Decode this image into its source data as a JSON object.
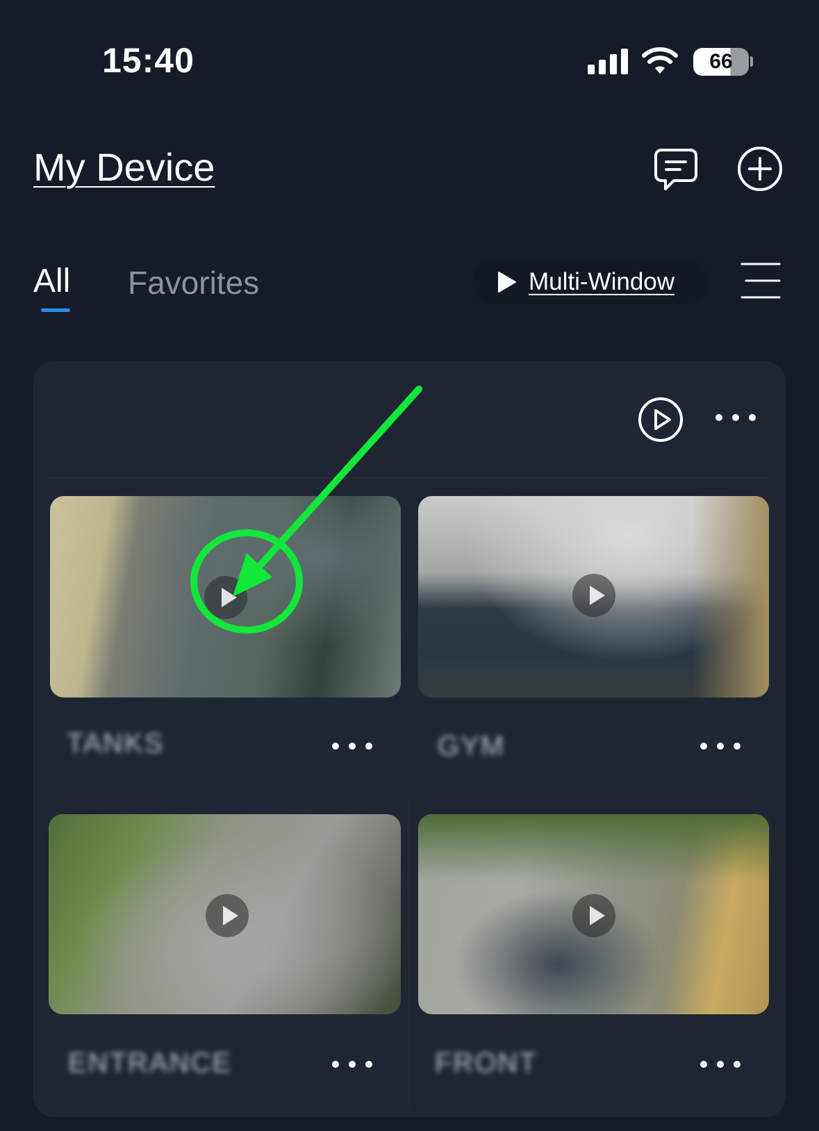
{
  "status_bar": {
    "time": "15:40",
    "battery": "66"
  },
  "header": {
    "title": "My Device"
  },
  "tabs": [
    {
      "label": "All",
      "selected": true
    },
    {
      "label": "Favorites",
      "selected": false
    }
  ],
  "multi_window": {
    "label": "Multi-Window"
  },
  "devices": [
    {
      "name": "TANKS"
    },
    {
      "name": "GYM"
    },
    {
      "name": "ENTRANCE"
    },
    {
      "name": "FRONT"
    }
  ],
  "annotation": {
    "color": "#12e83a"
  }
}
